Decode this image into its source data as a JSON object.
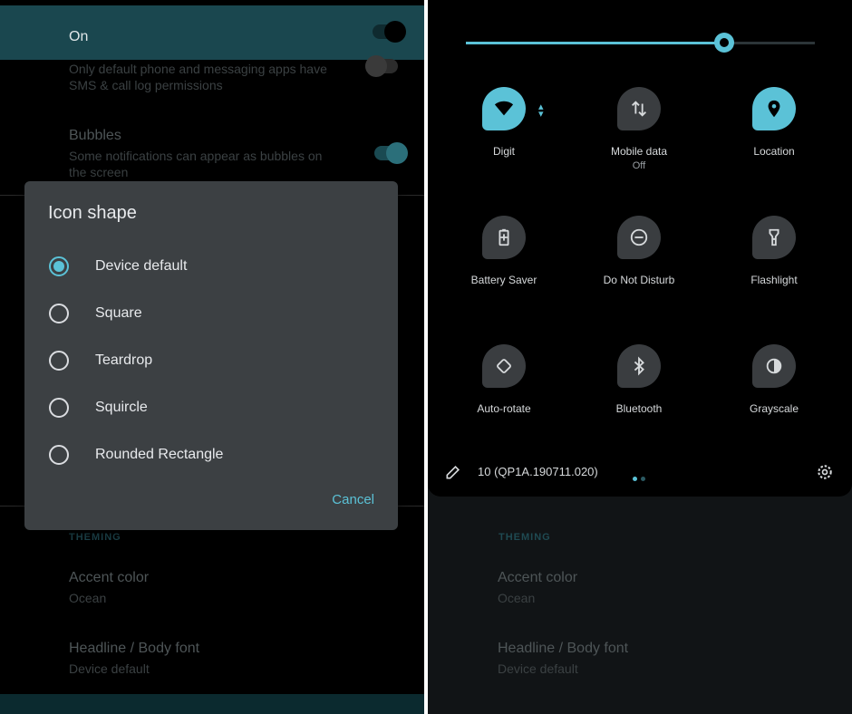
{
  "left_panel": {
    "top_toggle_label": "On",
    "sms_permission_text": "Only default phone and messaging apps have SMS & call log permissions",
    "bubbles": {
      "title": "Bubbles",
      "subtitle": "Some notifications can appear as bubbles on the screen"
    },
    "theming_header": "THEMING",
    "accent_color": {
      "title": "Accent color",
      "value": "Ocean"
    },
    "headline_font": {
      "title": "Headline / Body font",
      "value": "Device default"
    },
    "dialog": {
      "title": "Icon shape",
      "options": [
        {
          "label": "Device default",
          "selected": true
        },
        {
          "label": "Square",
          "selected": false
        },
        {
          "label": "Teardrop",
          "selected": false
        },
        {
          "label": "Squircle",
          "selected": false
        },
        {
          "label": "Rounded Rectangle",
          "selected": false
        }
      ],
      "cancel_label": "Cancel"
    }
  },
  "right_panel": {
    "brightness_level": 0.74,
    "tiles": [
      {
        "label": "Digit",
        "sub": "",
        "icon": "wifi-icon",
        "active": true
      },
      {
        "label": "Mobile data",
        "sub": "Off",
        "icon": "mobile-data-icon",
        "active": false
      },
      {
        "label": "Location",
        "sub": "",
        "icon": "location-icon",
        "active": true
      },
      {
        "label": "Battery Saver",
        "sub": "",
        "icon": "battery-saver-icon",
        "active": false
      },
      {
        "label": "Do Not Disturb",
        "sub": "",
        "icon": "do-not-disturb-icon",
        "active": false
      },
      {
        "label": "Flashlight",
        "sub": "",
        "icon": "flashlight-icon",
        "active": false
      },
      {
        "label": "Auto-rotate",
        "sub": "",
        "icon": "auto-rotate-icon",
        "active": false
      },
      {
        "label": "Bluetooth",
        "sub": "",
        "icon": "bluetooth-icon",
        "active": false
      },
      {
        "label": "Grayscale",
        "sub": "",
        "icon": "grayscale-icon",
        "active": false
      }
    ],
    "build_number": "10 (QP1A.190711.020)",
    "page_dots": 2,
    "theming_header": "THEMING",
    "accent_color": {
      "title": "Accent color",
      "value": "Ocean"
    },
    "headline_font": {
      "title": "Headline / Body font",
      "value": "Device default"
    }
  },
  "colors": {
    "accent": "#5bc2d7",
    "dialog_bg": "#3c4043",
    "tile_off": "#3a3d40"
  }
}
